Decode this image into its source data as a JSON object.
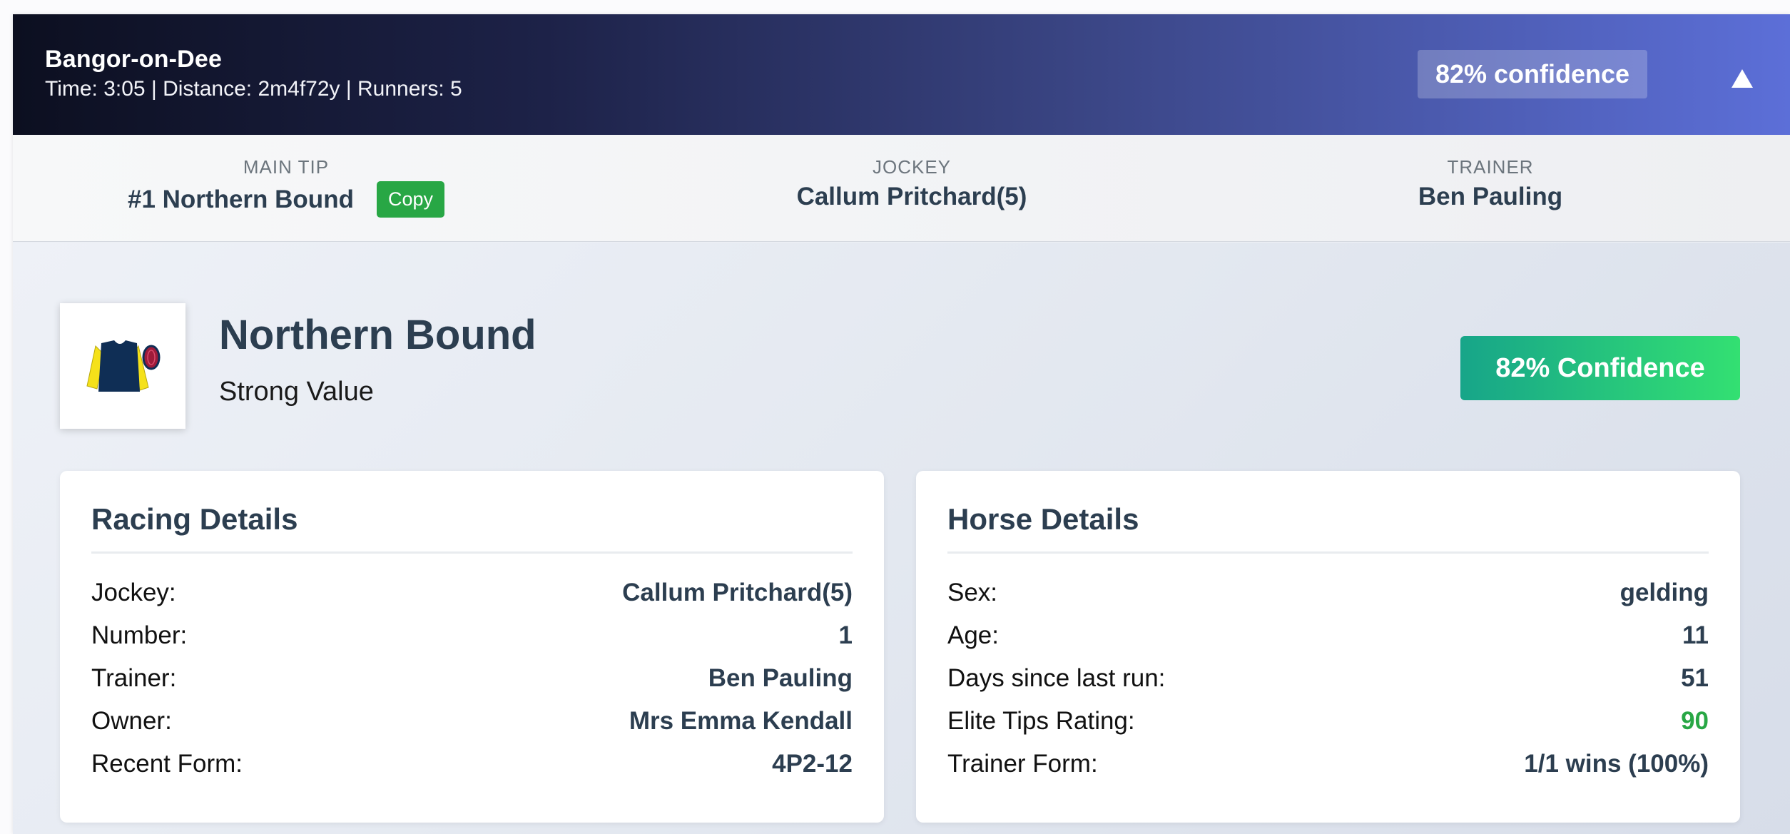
{
  "race": {
    "course": "Bangor-on-Dee",
    "meta": "Time: 3:05 | Distance: 2m4f72y | Runners: 5",
    "confidence_pill": "82% confidence",
    "toggle_icon": "triangle-up-icon"
  },
  "summary": {
    "main_tip_label": "MAIN TIP",
    "main_tip_value": "#1 Northern Bound",
    "copy_label": "Copy",
    "jockey_label": "JOCKEY",
    "jockey_value": "Callum Pritchard(5)",
    "trainer_label": "TRAINER",
    "trainer_value": "Ben Pauling"
  },
  "horse": {
    "name": "Northern Bound",
    "tag": "Strong Value",
    "confidence_badge": "82% Confidence",
    "silk_colors": {
      "body": "#0f2e55",
      "sleeves": "#f5e11a",
      "cap": "#9e1b3a",
      "cap_trim": "#0f2e55"
    }
  },
  "racing_details": {
    "title": "Racing Details",
    "rows": [
      {
        "label": "Jockey:",
        "value": "Callum Pritchard(5)"
      },
      {
        "label": "Number:",
        "value": "1"
      },
      {
        "label": "Trainer:",
        "value": "Ben Pauling"
      },
      {
        "label": "Owner:",
        "value": "Mrs Emma Kendall"
      },
      {
        "label": "Recent Form:",
        "value": "4P2-12"
      }
    ]
  },
  "horse_details": {
    "title": "Horse Details",
    "rows": [
      {
        "label": "Sex:",
        "value": "gelding"
      },
      {
        "label": "Age:",
        "value": "11"
      },
      {
        "label": "Days since last run:",
        "value": "51"
      },
      {
        "label": "Elite Tips Rating:",
        "value": "90"
      },
      {
        "label": "Trainer Form:",
        "value": "1/1 wins (100%)"
      }
    ]
  },
  "colors": {
    "rating_green": "#28a745",
    "copy_green": "#28a745",
    "text_dark": "#2c3e50"
  }
}
